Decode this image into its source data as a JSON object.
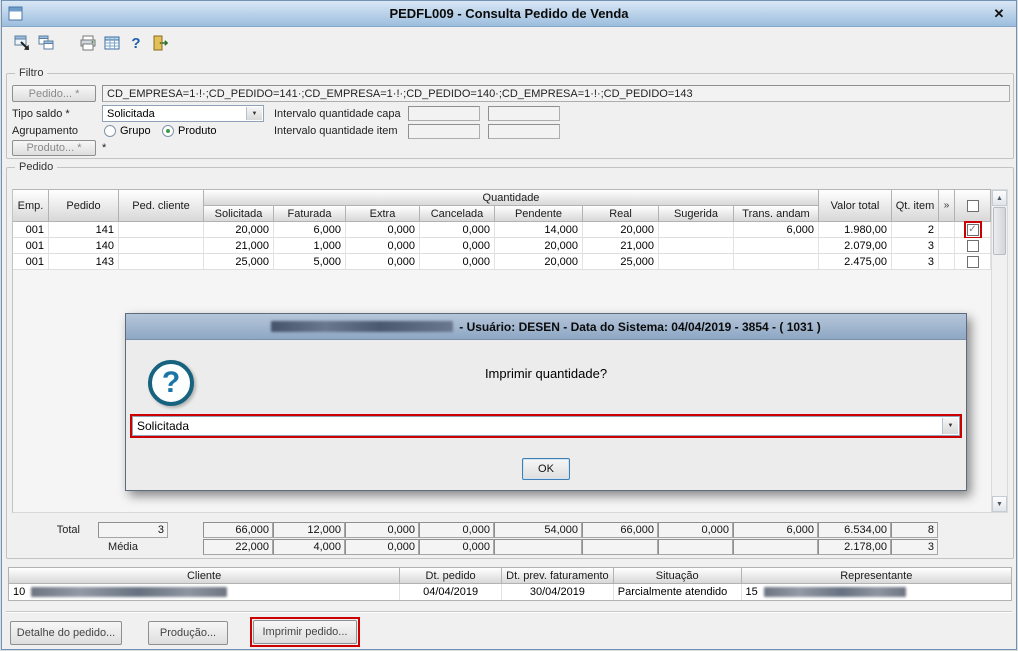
{
  "window": {
    "title": "PEDFL009 - Consulta Pedido de Venda",
    "close_glyph": "✕"
  },
  "glyphs": {
    "up": "▲",
    "down": "▼",
    "check": "✓",
    "chevron": "»",
    "help": "?"
  },
  "filtro": {
    "legend": "Filtro",
    "pedido_button": "Pedido... *",
    "pedido_value": "CD_EMPRESA=1·!·;CD_PEDIDO=141·;CD_EMPRESA=1·!·;CD_PEDIDO=140·;CD_EMPRESA=1·!·;CD_PEDIDO=143",
    "tipo_saldo_label": "Tipo saldo *",
    "tipo_saldo_value": "Solicitada",
    "intervalo_capa_label": "Intervalo quantidade capa",
    "intervalo_item_label": "Intervalo quantidade item",
    "agrupamento_label": "Agrupamento",
    "radio_grupo": "Grupo",
    "radio_produto": "Produto",
    "produto_button": "Produto... *",
    "produto_value": "*"
  },
  "pedido": {
    "legend": "Pedido",
    "quantidade_header": "Quantidade",
    "headers": {
      "emp": "Emp.",
      "pedido": "Pedido",
      "ped_cliente": "Ped. cliente",
      "valor_total": "Valor total",
      "qt_item": "Qt. item"
    },
    "subheaders": [
      "Solicitada",
      "Faturada",
      "Extra",
      "Cancelada",
      "Pendente",
      "Real",
      "Sugerida",
      "Trans. andam"
    ],
    "rows": [
      {
        "cells": [
          "001",
          "141",
          "",
          "20,000",
          "6,000",
          "0,000",
          "0,000",
          "14,000",
          "20,000",
          "",
          "6,000",
          "1.980,00",
          "2"
        ],
        "checked": true
      },
      {
        "cells": [
          "001",
          "140",
          "",
          "21,000",
          "1,000",
          "0,000",
          "0,000",
          "20,000",
          "21,000",
          "",
          "",
          "2.079,00",
          "3"
        ],
        "checked": false
      },
      {
        "cells": [
          "001",
          "143",
          "",
          "25,000",
          "5,000",
          "0,000",
          "0,000",
          "20,000",
          "25,000",
          "",
          "",
          "2.475,00",
          "3"
        ],
        "checked": false
      }
    ]
  },
  "dialog": {
    "title_text": "- Usuário: DESEN - Data do Sistema: 04/04/2019 - 3854 - ( 1031 )",
    "question": "Imprimir quantidade?",
    "combo_value": "Solicitada",
    "ok_label": "OK"
  },
  "totais": {
    "total_label": "Total",
    "total_value": "3",
    "media_label": "Média",
    "total_cells": [
      "66,000",
      "12,000",
      "0,000",
      "0,000",
      "54,000",
      "66,000",
      "0,000",
      "6,000",
      "6.534,00",
      "8"
    ],
    "media_cells": [
      "22,000",
      "4,000",
      "0,000",
      "0,000",
      "",
      "",
      "",
      "",
      "2.178,00",
      "3"
    ]
  },
  "cliente": {
    "headers": [
      "Cliente",
      "Dt. pedido",
      "Dt. prev. faturamento",
      "Situação",
      "Representante"
    ],
    "row": {
      "cliente_code": "10",
      "dt_pedido": "04/04/2019",
      "dt_prev_faturamento": "30/04/2019",
      "situacao": "Parcialmente atendido",
      "representante_code": "15"
    }
  },
  "footer": {
    "detalhe_button": "Detalhe do pedido...",
    "producao_button": "Produção...",
    "imprimir_button": "Imprimir pedido..."
  },
  "colors": {
    "highlight": "#cc0000",
    "titlebar": "#9cbede",
    "dialog_titlebar": "#8ea7c4"
  }
}
